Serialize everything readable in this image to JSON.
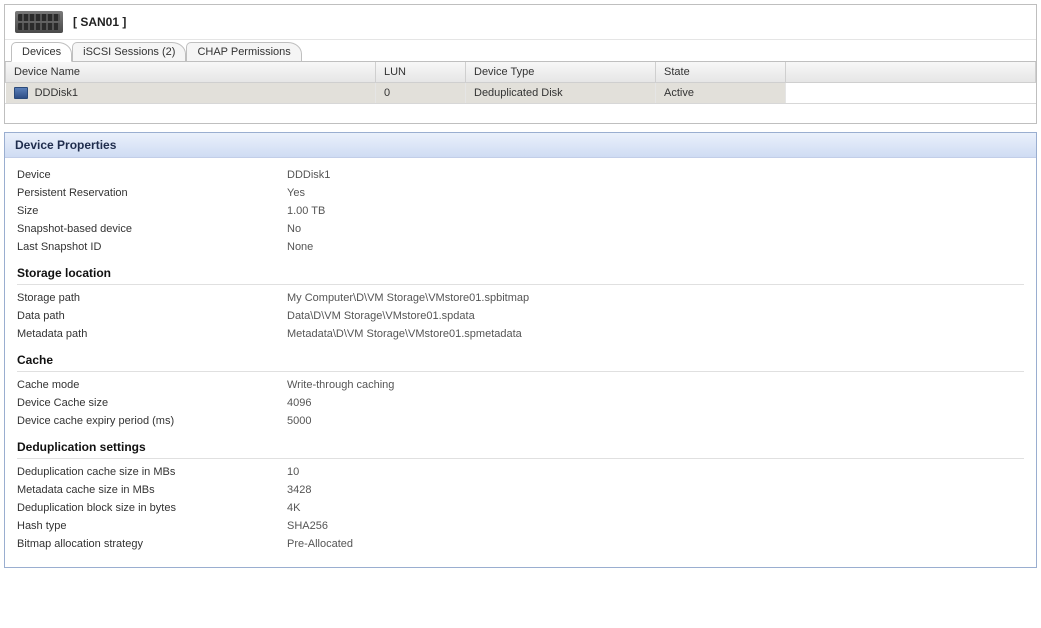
{
  "header": {
    "title": "[ SAN01 ]"
  },
  "tabs": [
    {
      "label": "Devices",
      "active": true
    },
    {
      "label": "iSCSI Sessions (2)",
      "active": false
    },
    {
      "label": "CHAP Permissions",
      "active": false
    }
  ],
  "deviceTable": {
    "columns": {
      "name": "Device Name",
      "lun": "LUN",
      "type": "Device Type",
      "state": "State"
    },
    "rows": [
      {
        "name": "DDDisk1",
        "lun": "0",
        "type": "Deduplicated Disk",
        "state": "Active"
      }
    ]
  },
  "propsPanel": {
    "title": "Device Properties",
    "general": {
      "device": {
        "label": "Device",
        "value": "DDDisk1"
      },
      "persistentReservation": {
        "label": "Persistent Reservation",
        "value": "Yes"
      },
      "size": {
        "label": "Size",
        "value": "1.00 TB"
      },
      "snapshotBased": {
        "label": "Snapshot-based device",
        "value": "No"
      },
      "lastSnapshotId": {
        "label": "Last Snapshot ID",
        "value": "None"
      }
    },
    "storage": {
      "title": "Storage location",
      "storagePath": {
        "label": "Storage path",
        "value": "My Computer\\D\\VM Storage\\VMstore01.spbitmap"
      },
      "dataPath": {
        "label": "Data path",
        "value": "Data\\D\\VM Storage\\VMstore01.spdata"
      },
      "metadataPath": {
        "label": "Metadata path",
        "value": "Metadata\\D\\VM Storage\\VMstore01.spmetadata"
      }
    },
    "cache": {
      "title": "Cache",
      "mode": {
        "label": "Cache mode",
        "value": "Write-through caching"
      },
      "size": {
        "label": "Device Cache size",
        "value": "4096"
      },
      "expiry": {
        "label": "Device cache expiry period (ms)",
        "value": "5000"
      }
    },
    "dedup": {
      "title": "Deduplication settings",
      "cacheMb": {
        "label": "Deduplication cache size in MBs",
        "value": "10"
      },
      "metaMb": {
        "label": "Metadata cache size in MBs",
        "value": "3428"
      },
      "blockBytes": {
        "label": "Deduplication block size in bytes",
        "value": "4K"
      },
      "hash": {
        "label": "Hash type",
        "value": "SHA256"
      },
      "bitmap": {
        "label": "Bitmap allocation strategy",
        "value": "Pre-Allocated"
      }
    }
  }
}
